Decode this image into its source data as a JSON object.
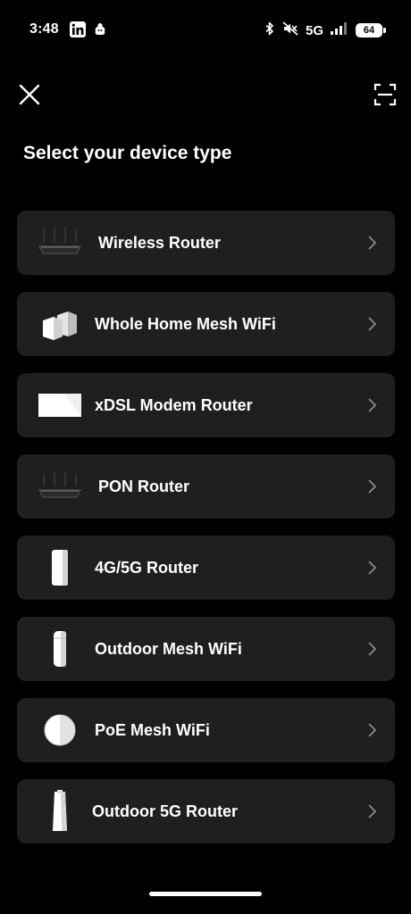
{
  "status_bar": {
    "time": "3:48",
    "network": "5G",
    "battery": "64"
  },
  "header": {
    "close_icon": "close-icon",
    "scan_icon": "scan-icon"
  },
  "title": "Select your device type",
  "devices": [
    {
      "label": "Wireless Router",
      "icon": "wireless-router-icon"
    },
    {
      "label": "Whole Home Mesh WiFi",
      "icon": "mesh-wifi-icon"
    },
    {
      "label": "xDSL Modem Router",
      "icon": "xdsl-modem-icon"
    },
    {
      "label": "PON Router",
      "icon": "pon-router-icon"
    },
    {
      "label": "4G/5G Router",
      "icon": "cellular-router-icon"
    },
    {
      "label": "Outdoor Mesh WiFi",
      "icon": "outdoor-mesh-icon"
    },
    {
      "label": "PoE Mesh WiFi",
      "icon": "poe-mesh-icon"
    },
    {
      "label": "Outdoor 5G Router",
      "icon": "outdoor-5g-router-icon"
    }
  ],
  "colors": {
    "background": "#000000",
    "card": "#1f1f1f",
    "text": "#ffffff",
    "chevron": "#8a8a8a"
  }
}
